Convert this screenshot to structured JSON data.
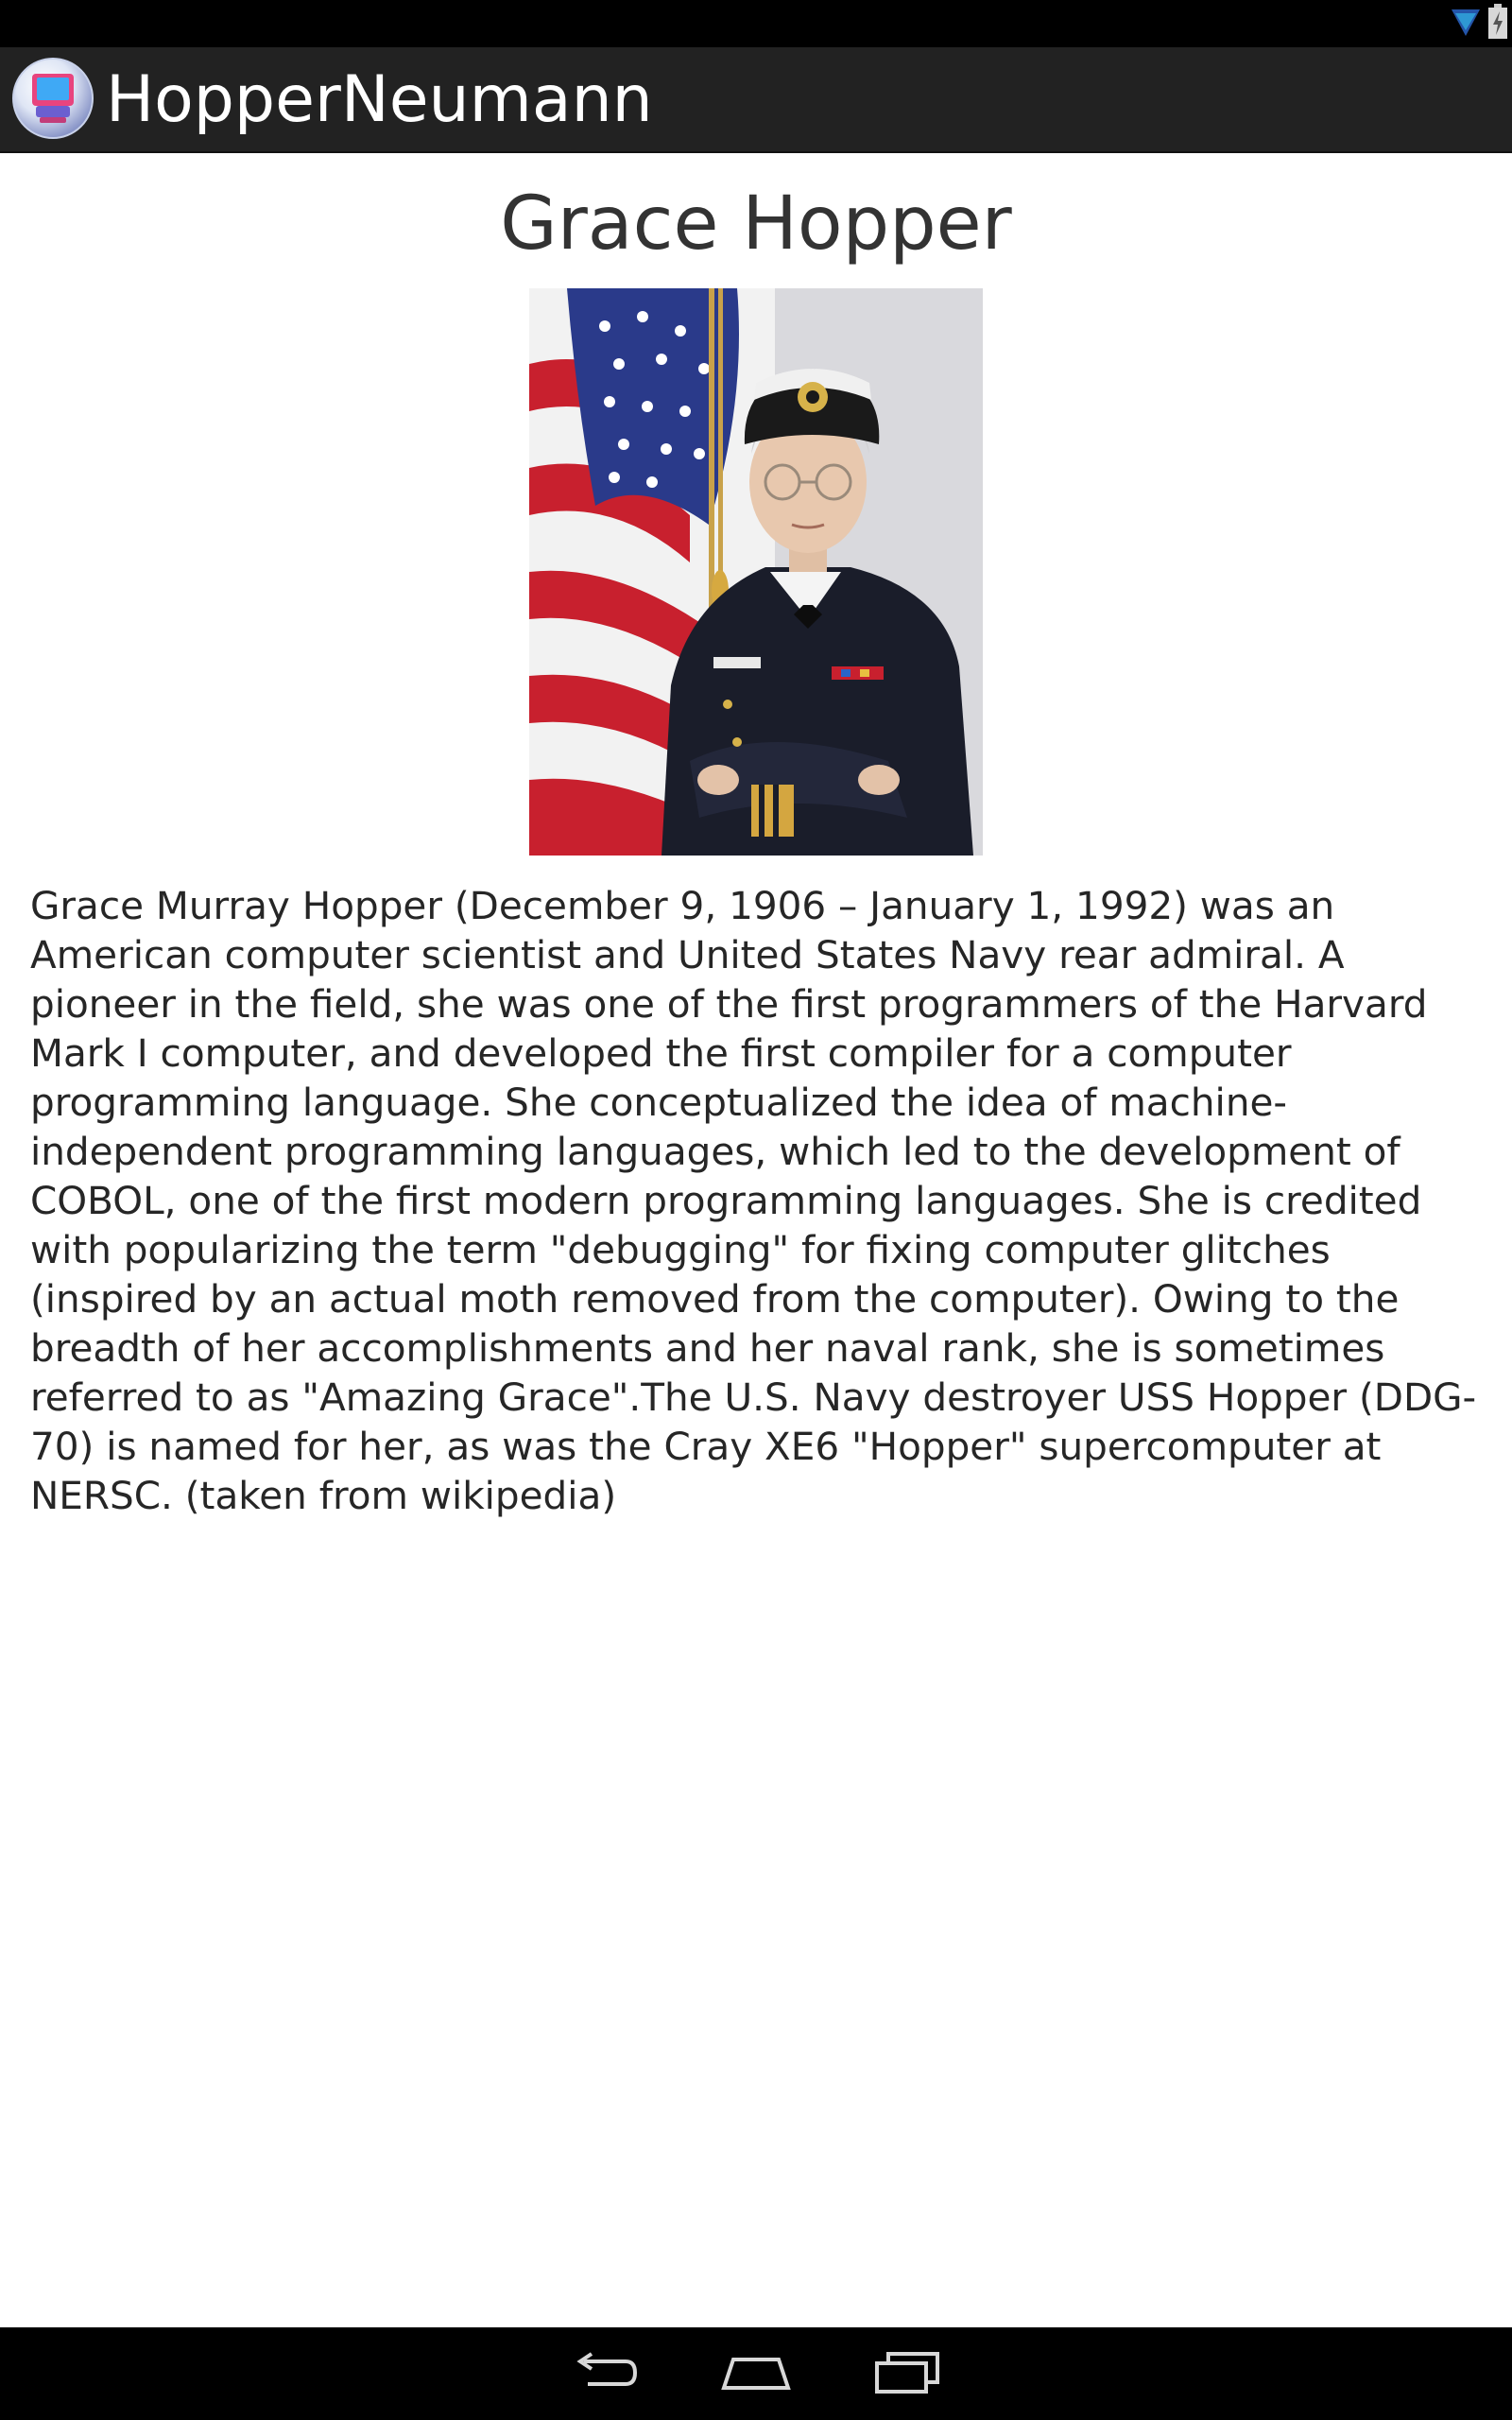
{
  "app": {
    "title": "HopperNeumann"
  },
  "profile": {
    "name": "Grace Hopper",
    "bio": "Grace Murray Hopper (December 9, 1906 – January 1, 1992) was an American computer scientist and United States Navy rear admiral. A pioneer in the field, she was one of the first programmers of the Harvard Mark I computer, and developed the first compiler for a computer programming language. She conceptualized the idea of machine-independent programming languages, which led to the development of COBOL, one of the first modern programming languages. She is credited with popularizing the term \"debugging\" for fixing computer glitches (inspired by an actual moth removed from the computer). Owing to the breadth of her accomplishments and her naval rank, she is sometimes referred to as \"Amazing Grace\".The U.S. Navy destroyer USS Hopper (DDG-70) is named for her, as was the Cray XE6 \"Hopper\" supercomputer at NERSC. (taken from wikipedia)"
  },
  "icons": {
    "status": [
      "wifi-icon",
      "battery-icon"
    ],
    "app": "app-computer-icon",
    "nav": [
      "back-icon",
      "home-icon",
      "recent-apps-icon"
    ]
  },
  "colors": {
    "status_bar": "#000000",
    "action_bar": "#222222",
    "nav_bar": "#000000",
    "background": "#ffffff",
    "status_icon_accent": "#33b5e5"
  }
}
